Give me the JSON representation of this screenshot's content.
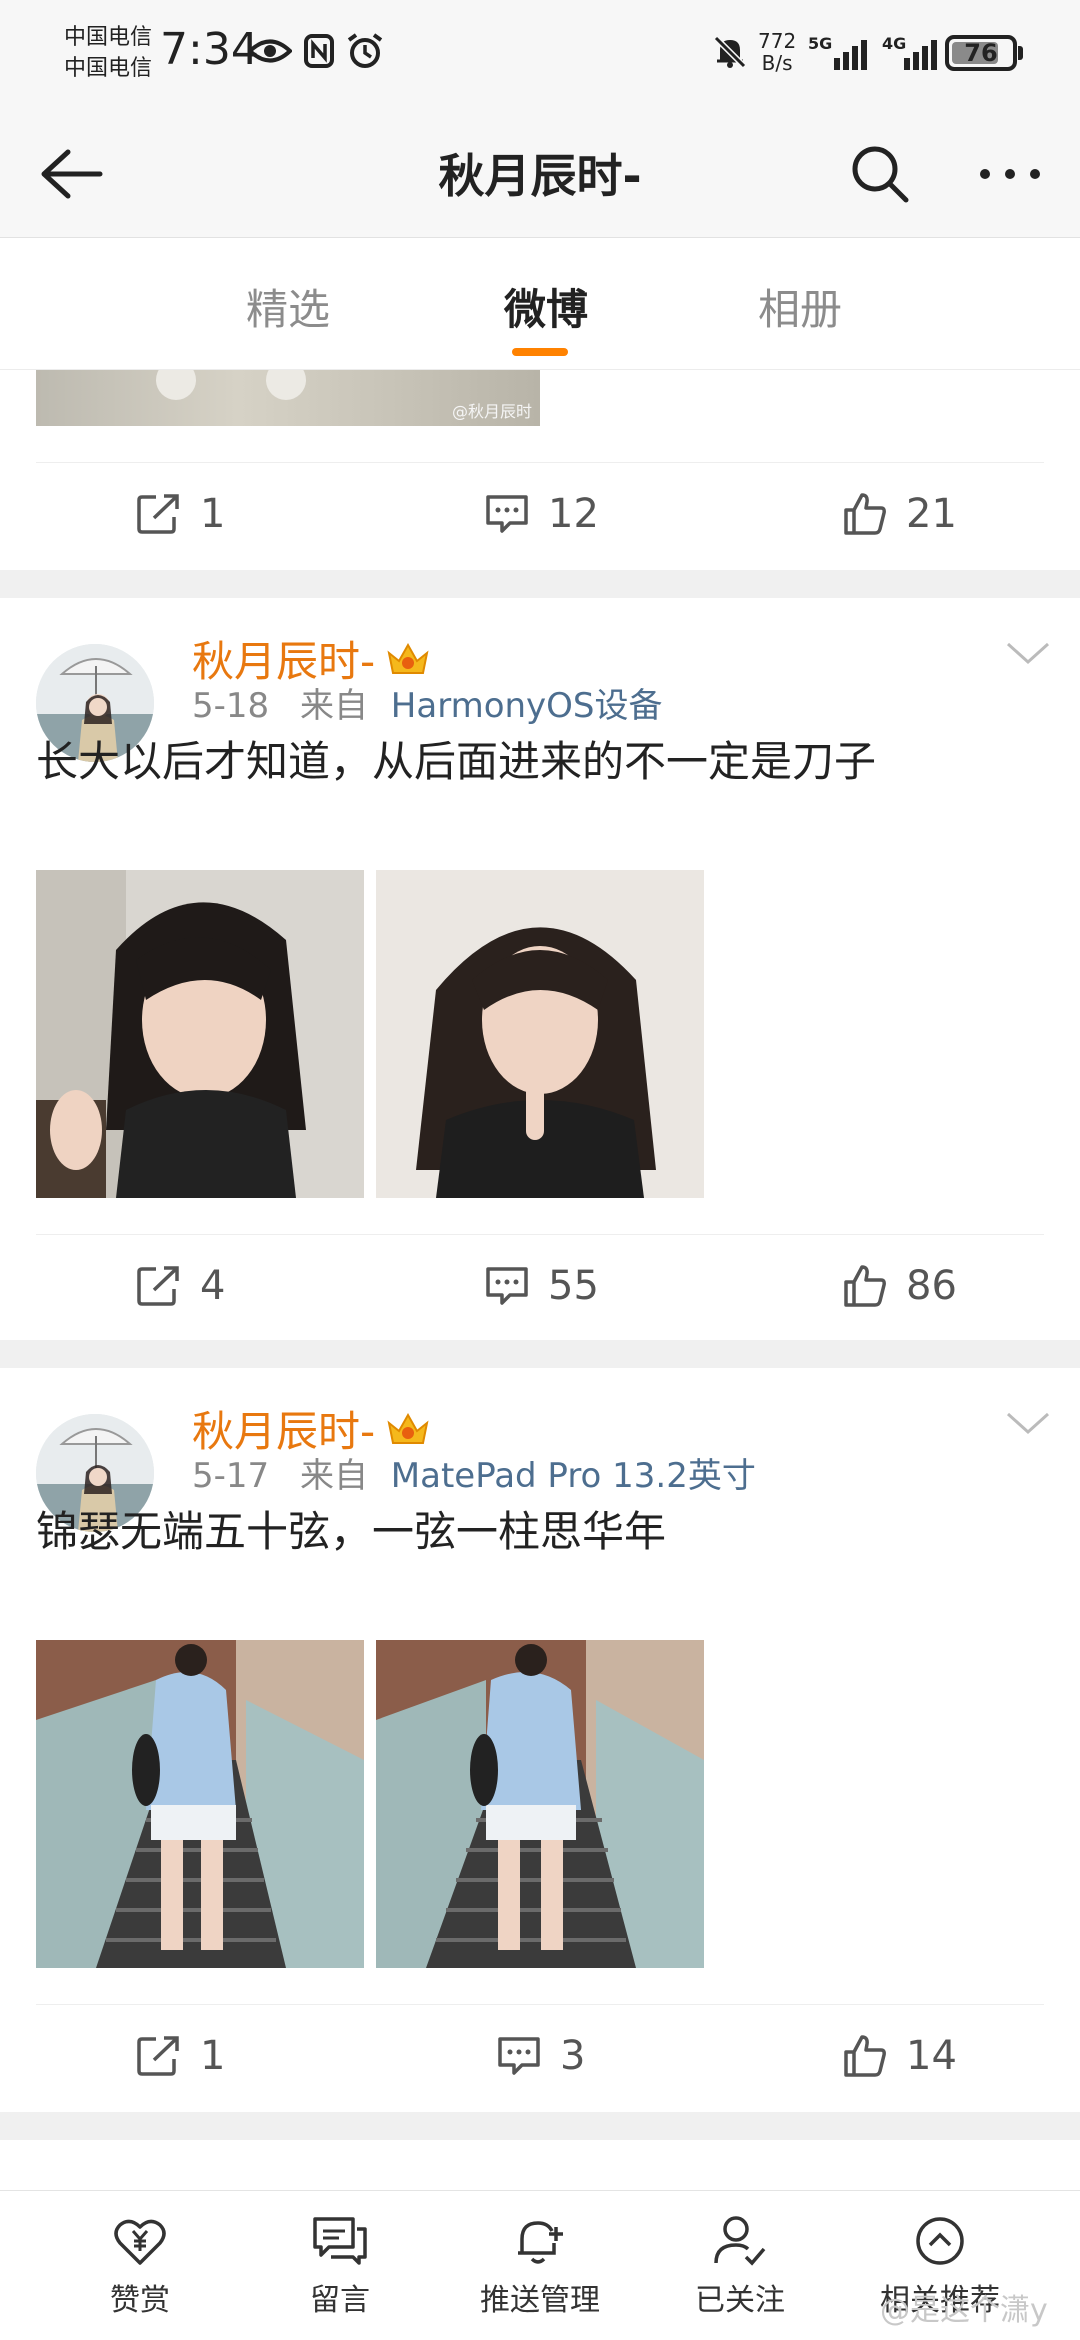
{
  "status_bar": {
    "carrier_1": "中国电信",
    "carrier_2": "中国电信",
    "time": "7:34",
    "net_speed_value": "772",
    "net_speed_unit": "B/s",
    "signal_1": "5G",
    "signal_2": "4G",
    "battery": "76"
  },
  "header": {
    "title": "秋月辰时-"
  },
  "tabs": [
    {
      "label": "精选"
    },
    {
      "label": "微博"
    },
    {
      "label": "相册"
    }
  ],
  "active_tab": "微博",
  "top_strip": {
    "watermark": "@秋月辰时"
  },
  "posts": [
    {
      "actions": {
        "repost": "1",
        "comment": "12",
        "like": "21"
      }
    },
    {
      "author": "秋月辰时-",
      "date": "5-18",
      "source_prefix": "来自",
      "device": "HarmonyOS设备",
      "text": "长大以后才知道，从后面进来的不一定是刀子",
      "actions": {
        "repost": "4",
        "comment": "55",
        "like": "86"
      }
    },
    {
      "author": "秋月辰时-",
      "date": "5-17",
      "source_prefix": "来自",
      "device": "MatePad Pro 13.2英寸",
      "text": "锦瑟无端五十弦，一弦一柱思华年",
      "actions": {
        "repost": "1",
        "comment": "3",
        "like": "14"
      }
    }
  ],
  "bottom_bar": [
    {
      "label": "赞赏"
    },
    {
      "label": "留言"
    },
    {
      "label": "推送管理"
    },
    {
      "label": "已关注"
    },
    {
      "label": "相关推荐"
    }
  ],
  "watermark": "@是这个潇y",
  "colors": {
    "accent": "#ff8200",
    "author_name": "#e8780f",
    "device_link": "#4d6e8f",
    "separator": "#f0f0f0"
  }
}
